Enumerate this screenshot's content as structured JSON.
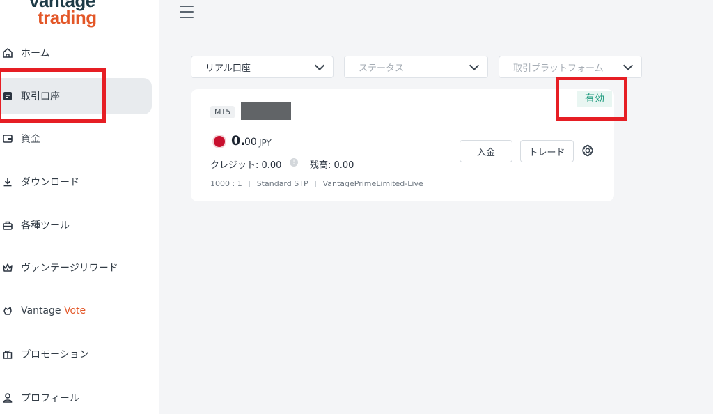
{
  "brand": {
    "line1": "vantage",
    "line2": "trading"
  },
  "sidebar": {
    "items": [
      {
        "label": "ホーム",
        "icon": "home-icon"
      },
      {
        "label": "取引口座",
        "icon": "account-icon",
        "active": true
      },
      {
        "label": "資金",
        "icon": "wallet-icon"
      },
      {
        "label": "ダウンロード",
        "icon": "download-icon"
      },
      {
        "label": "各種ツール",
        "icon": "toolbox-icon"
      },
      {
        "label": "ヴァンテージリワード",
        "icon": "crown-icon"
      },
      {
        "label": "Vantage",
        "label_accent": "Vote",
        "icon": "vote-icon"
      },
      {
        "label": "プロモーション",
        "icon": "gift-icon"
      },
      {
        "label": "プロフィール",
        "icon": "user-icon"
      }
    ]
  },
  "filters": {
    "account_type": {
      "value": "リアル口座"
    },
    "status": {
      "placeholder": "ステータス"
    },
    "platform": {
      "placeholder": "取引プラットフォーム"
    }
  },
  "account": {
    "platform_badge": "MT5",
    "balance_int": "0.",
    "balance_dec": "00",
    "currency": "JPY",
    "credit_label": "クレジット: 0.00",
    "balance_label": "残高:  0.00",
    "leverage": "1000 : 1",
    "account_type": "Standard STP",
    "server": "VantagePrimeLimited-Live",
    "status": "有効",
    "deposit_button": "入金",
    "trade_button": "トレード"
  },
  "colors": {
    "accent": "#e35728",
    "highlight_box": "#e61e24",
    "status_green": "#1d9b7d",
    "flag_red": "#c8102e"
  }
}
